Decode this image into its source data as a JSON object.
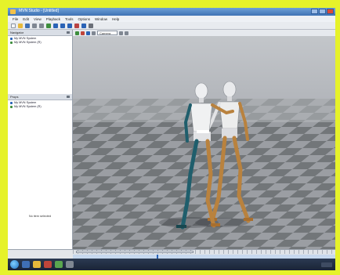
{
  "window": {
    "title": "MVN Studio - [Untitled]",
    "buttons": [
      "minimize",
      "maximize",
      "close"
    ]
  },
  "menu": [
    "File",
    "Edit",
    "View",
    "Playback",
    "Tools",
    "Options",
    "Window",
    "Help"
  ],
  "toolbar": {
    "icons": [
      "new-icon",
      "open-icon",
      "save-icon",
      "undo-icon",
      "redo-icon",
      "record-icon",
      "rewind-icon",
      "play-icon",
      "forward-icon",
      "settings-icon"
    ],
    "combo_value": "Camera"
  },
  "panels": {
    "top_title": "Navigator",
    "top_items": [
      "My MVN System",
      "My MVN System (R)"
    ],
    "bottom_title": "Props",
    "bottom_items": [
      "My MVN System",
      "My MVN System (R)"
    ],
    "empty_text": "No item selected"
  },
  "colors": {
    "accent": "#2a63b6",
    "figure_left_limbs": "#1f5e6c",
    "figure_right_limbs": "#b9823e",
    "floor_light": "#9b9ea3",
    "floor_dark": "#6f7378"
  },
  "timeline": {
    "playhead_fraction": 0.32
  }
}
